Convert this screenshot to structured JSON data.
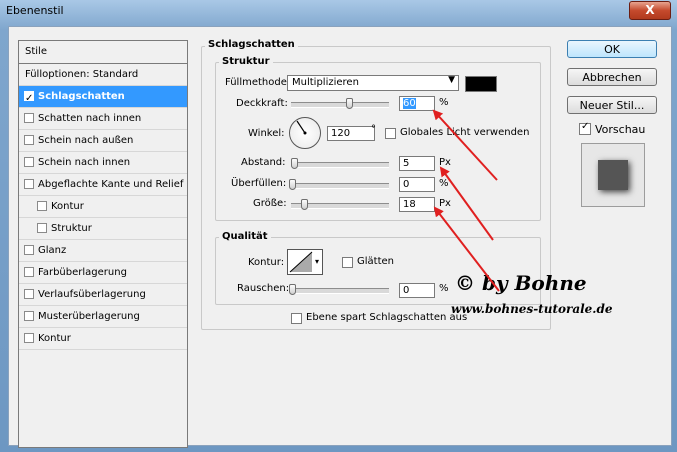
{
  "window": {
    "title": "Ebenenstil",
    "close_glyph": "X"
  },
  "stylelist": {
    "header": "Stile",
    "blend_options": "Fülloptionen: Standard",
    "items": [
      {
        "label": "Schlagschatten",
        "checked": true,
        "selected": true
      },
      {
        "label": "Schatten nach innen",
        "checked": false
      },
      {
        "label": "Schein nach außen",
        "checked": false
      },
      {
        "label": "Schein nach innen",
        "checked": false
      },
      {
        "label": "Abgeflachte Kante und Relief",
        "checked": false
      },
      {
        "label": "Kontur",
        "checked": false,
        "sub": true
      },
      {
        "label": "Struktur",
        "checked": false,
        "sub": true
      },
      {
        "label": "Glanz",
        "checked": false
      },
      {
        "label": "Farbüberlagerung",
        "checked": false
      },
      {
        "label": "Verlaufsüberlagerung",
        "checked": false
      },
      {
        "label": "Musterüberlagerung",
        "checked": false
      },
      {
        "label": "Kontur",
        "checked": false
      }
    ]
  },
  "panel": {
    "title": "Schlagschatten",
    "structure": {
      "title": "Struktur",
      "blend_mode_label": "Füllmethode:",
      "blend_mode_value": "Multiplizieren",
      "shadow_color": "#000000",
      "opacity_label": "Deckkraft:",
      "opacity_value": "60",
      "opacity_unit": "%",
      "opacity_fraction": 0.6,
      "angle_label": "Winkel:",
      "angle_value": "120",
      "angle_unit": "°",
      "global_light_label": "Globales Licht verwenden",
      "global_light_checked": false,
      "distance_label": "Abstand:",
      "distance_value": "5",
      "distance_unit": "Px",
      "spread_label": "Überfüllen:",
      "spread_value": "0",
      "spread_unit": "%",
      "size_label": "Größe:",
      "size_value": "18",
      "size_unit": "Px"
    },
    "quality": {
      "title": "Qualität",
      "contour_label": "Kontur:",
      "antialias_label": "Glätten",
      "antialias_checked": false,
      "noise_label": "Rauschen:",
      "noise_value": "0",
      "noise_unit": "%"
    },
    "knockout_label": "Ebene spart Schlagschatten aus",
    "knockout_checked": false
  },
  "buttons": {
    "ok": "OK",
    "cancel": "Abbrechen",
    "new_style": "Neuer Stil...",
    "preview_label": "Vorschau",
    "preview_checked": true
  },
  "watermark": {
    "line1": "© by Bohne",
    "line2": "www.bohnes-tutorale.de"
  },
  "colors": {
    "selection": "#3399ff",
    "arrow": "#e02020"
  }
}
